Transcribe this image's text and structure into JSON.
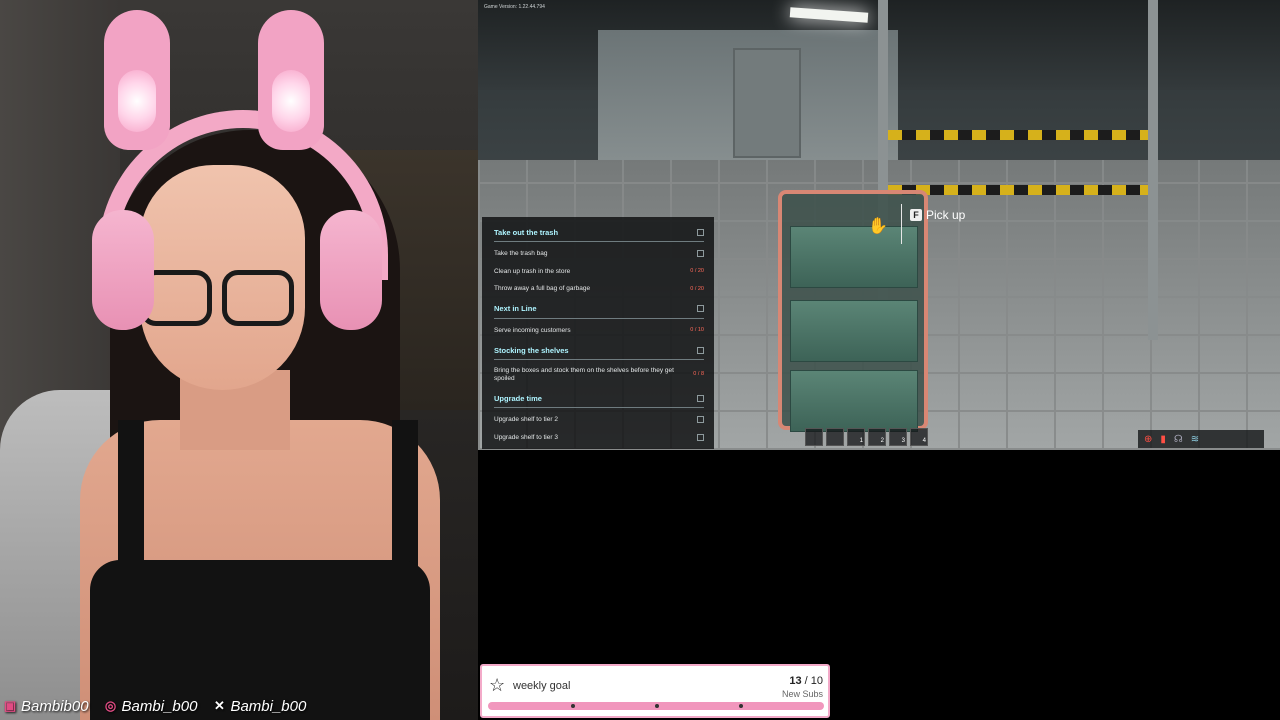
{
  "game": {
    "version": "Game Version: 1.22.44.794",
    "pickup_key": "F",
    "pickup_label": "Pick up",
    "hotbar": [
      "1",
      "2",
      "3",
      "4"
    ],
    "task_panel": [
      {
        "title": "Take out the trash",
        "items": [
          {
            "text": "Take the trash bag",
            "count": ""
          },
          {
            "text": "Clean up trash in the store",
            "count": "0 / 20"
          },
          {
            "text": "Throw away a full bag of garbage",
            "count": "0 / 20"
          }
        ]
      },
      {
        "title": "Next in Line",
        "items": [
          {
            "text": "Serve incoming customers",
            "count": "0 / 10"
          }
        ]
      },
      {
        "title": "Stocking the shelves",
        "items": [
          {
            "text": "Bring the boxes and stock them on the shelves before they get spoiled",
            "count": "0 / 8"
          }
        ]
      },
      {
        "title": "Upgrade time",
        "items": [
          {
            "text": "Upgrade shelf to tier 2",
            "count": ""
          },
          {
            "text": "Upgrade shelf to tier 3",
            "count": ""
          }
        ]
      }
    ]
  },
  "socials": [
    {
      "icon": "twitch-icon",
      "handle": "Bambib00"
    },
    {
      "icon": "instagram-icon",
      "handle": "Bambi_b00"
    },
    {
      "icon": "x-icon",
      "handle": "Bambi_b00"
    }
  ],
  "weekly_goal": {
    "title": "weekly goal",
    "current": "13",
    "separator": " / ",
    "target": "10",
    "label": "New Subs",
    "progress": 1.0
  },
  "colors": {
    "accent_pink": "#f3aac9",
    "task_heading": "#aef4ff",
    "task_count": "#ff6a5a"
  }
}
